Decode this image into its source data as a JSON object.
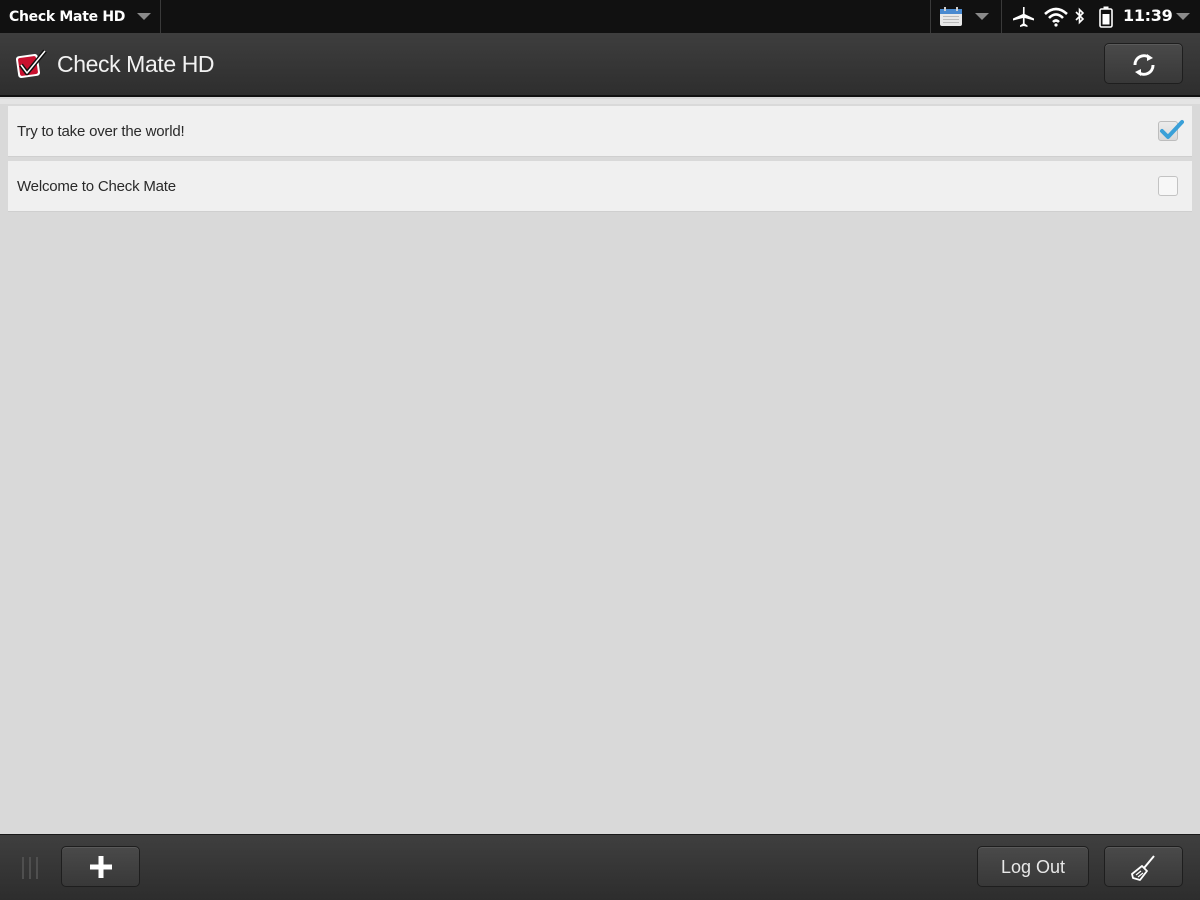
{
  "status_bar": {
    "app_name": "Check Mate HD",
    "time": "11:39",
    "icons": [
      "calendar-icon",
      "airplane-icon",
      "wifi-icon",
      "bluetooth-icon",
      "battery-icon"
    ]
  },
  "header": {
    "title": "Check Mate HD",
    "sync_icon": "sync-icon"
  },
  "tasks": [
    {
      "label": "Try to take over the world!",
      "checked": true
    },
    {
      "label": "Welcome to Check Mate",
      "checked": false
    }
  ],
  "bottom_bar": {
    "add_icon": "plus-icon",
    "logout_label": "Log Out",
    "clean_icon": "broom-icon"
  },
  "colors": {
    "check_accent": "#3aa0d8",
    "logo_red": "#c8102e"
  }
}
